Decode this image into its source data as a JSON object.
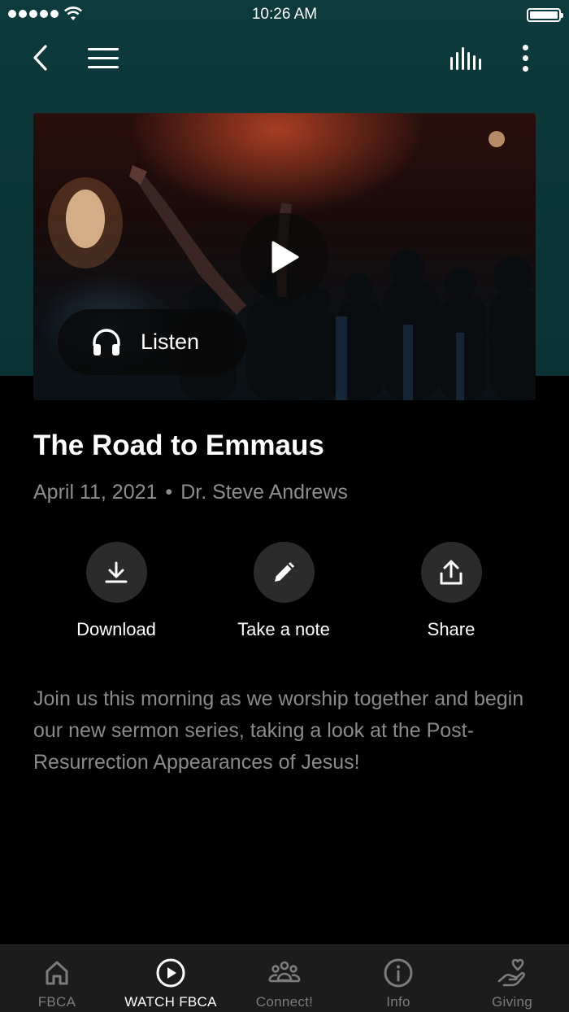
{
  "status_bar": {
    "time": "10:26 AM"
  },
  "nav": {
    "back_icon": "chevron-left-icon",
    "menu_icon": "hamburger-menu-icon",
    "bars_icon": "audio-bars-icon",
    "more_icon": "vertical-dots-icon"
  },
  "hero": {
    "play_icon": "play-icon",
    "listen_icon": "headphones-icon",
    "listen_label": "Listen"
  },
  "sermon": {
    "title": "The Road to Emmaus",
    "date": "April 11, 2021",
    "separator": "•",
    "speaker": "Dr. Steve Andrews",
    "description": "Join us this morning as we worship together and begin our new sermon series, taking a look at the Post-Resurrection Appearances of Jesus!"
  },
  "actions": [
    {
      "label": "Download",
      "icon": "download-icon"
    },
    {
      "label": "Take a note",
      "icon": "pencil-icon"
    },
    {
      "label": "Share",
      "icon": "share-icon"
    }
  ],
  "tabs": [
    {
      "label": "FBCA",
      "icon": "home-icon",
      "active": false
    },
    {
      "label": "WATCH FBCA",
      "icon": "play-circle-icon",
      "active": true
    },
    {
      "label": "Connect!",
      "icon": "group-icon",
      "active": false
    },
    {
      "label": "Info",
      "icon": "info-icon",
      "active": false
    },
    {
      "label": "Giving",
      "icon": "hand-heart-icon",
      "active": false
    }
  ],
  "colors": {
    "header_bg": "#0d3a3c",
    "page_bg": "#000000",
    "tab_bar_bg": "#1c1c1c",
    "muted_text": "#8a8a8a"
  }
}
